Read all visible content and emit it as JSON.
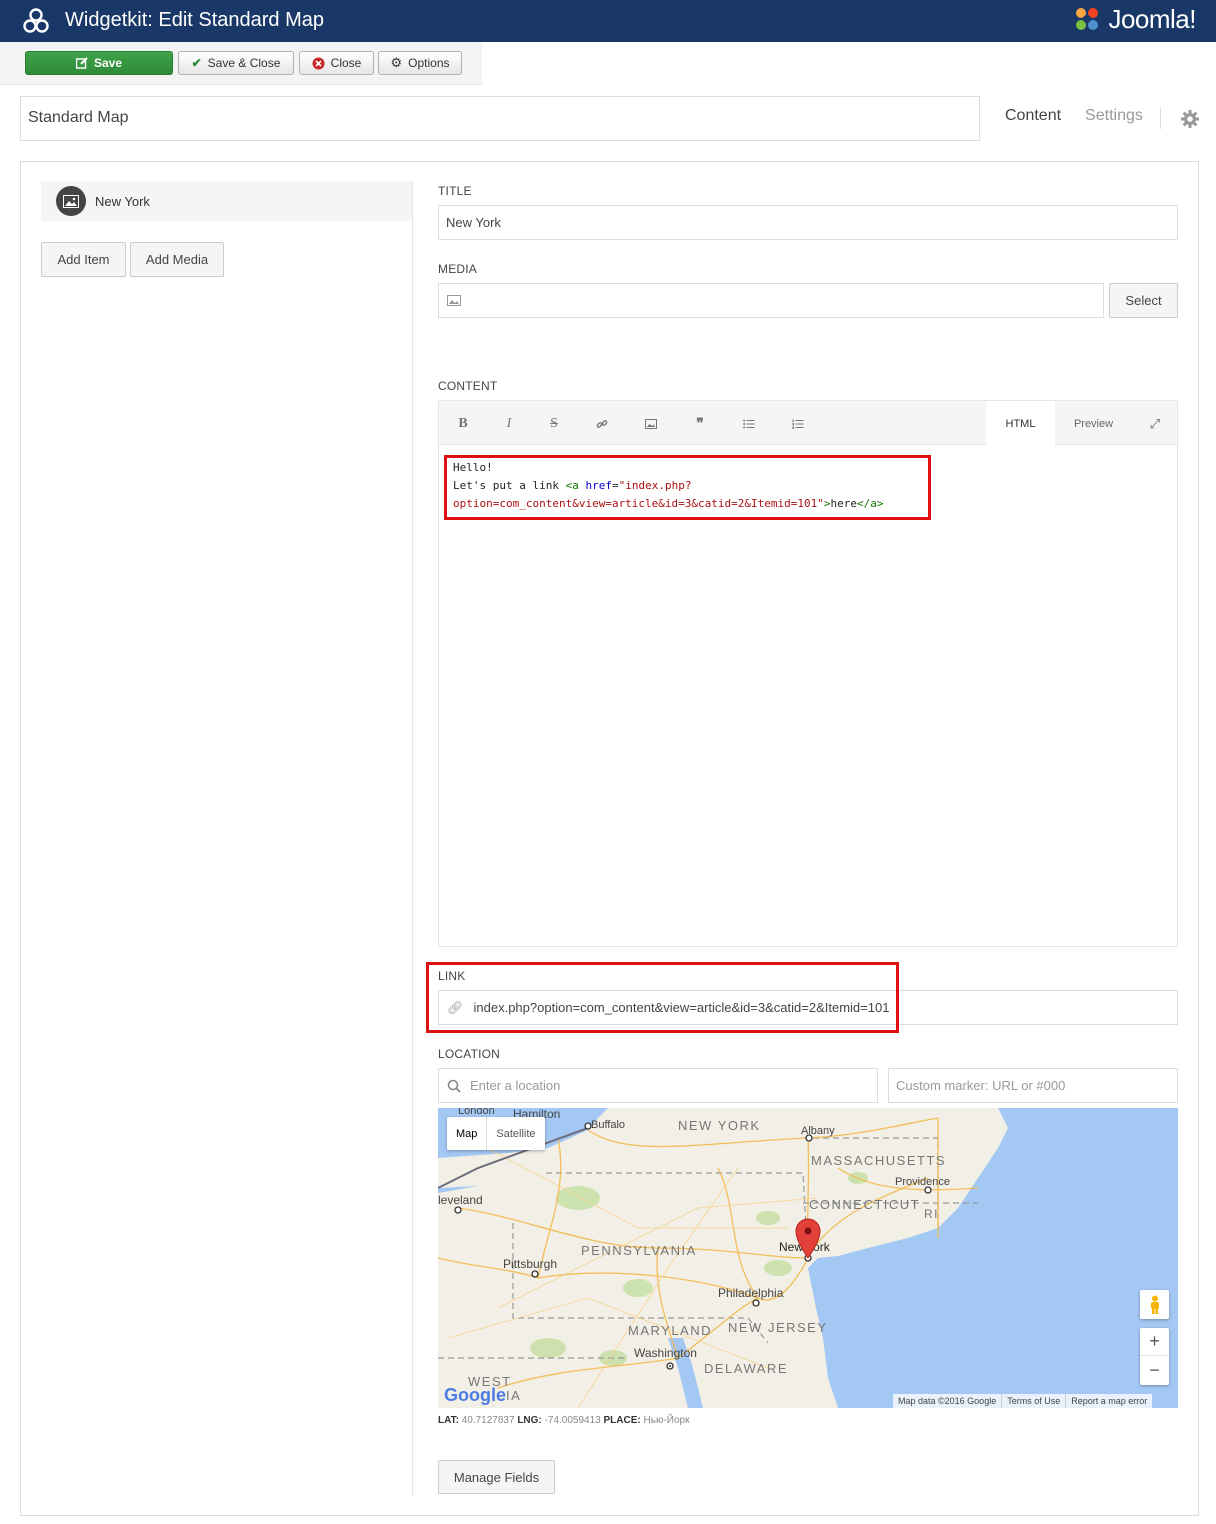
{
  "app": {
    "title": "Widgetkit: Edit Standard Map",
    "brand": "Joomla!",
    "brand_mark": "®"
  },
  "toolbar": {
    "save": "Save",
    "save_close": "Save & Close",
    "close": "Close",
    "options": "Options"
  },
  "widget": {
    "name": "Standard Map"
  },
  "tabs": {
    "content": "Content",
    "settings": "Settings"
  },
  "items": [
    {
      "label": "New York"
    }
  ],
  "item_actions": {
    "add_item": "Add Item",
    "add_media": "Add Media"
  },
  "fields": {
    "title_label": "TITLE",
    "title_value": "New York",
    "media_label": "MEDIA",
    "media_select": "Select",
    "content_label": "CONTENT",
    "link_label": "LINK",
    "link_value": "index.php?option=com_content&view=article&id=3&catid=2&Itemid=101",
    "location_label": "LOCATION",
    "location_placeholder": "Enter a location",
    "marker_placeholder": "Custom marker: URL or #000"
  },
  "editor": {
    "tab_html": "HTML",
    "tab_preview": "Preview",
    "tools": [
      "bold-icon",
      "italic-icon",
      "strikethrough-icon",
      "link-icon",
      "image-icon",
      "quote-icon",
      "list-ul-icon",
      "list-ol-icon"
    ],
    "line1": "Hello!",
    "line2_text": "Let's put a link ",
    "line2_tag_open": "<a ",
    "line2_attr": "href",
    "line2_eq": "=",
    "line2_str_start": "\"index.php?",
    "line3_str_end": "option=com_content&view=article&id=3&catid=2&Itemid=101\"",
    "line3_close": ">",
    "line3_text": "here",
    "line3_tag_close": "</a>"
  },
  "map": {
    "type_map": "Map",
    "type_satellite": "Satellite",
    "labels": [
      "London",
      "Hamilton",
      "Buffalo",
      "NEW YORK",
      "Albany",
      "MASSACHUSETTS",
      "Providence",
      "leveland",
      "CONNECTICUT",
      "RI",
      "PENNSYLVANIA",
      "New York",
      "Pittsburgh",
      "Philadelphia",
      "MARYLAND",
      "NEW JERSEY",
      "Washington",
      "DELAWARE",
      "WEST",
      "IA"
    ],
    "zoom_in": "+",
    "zoom_out": "−",
    "attribution": [
      "Map data ©2016 Google",
      "Terms of Use",
      "Report a map error"
    ],
    "google": "Google",
    "colors": {
      "land": "#f2efe6",
      "water": "#a4c8f4",
      "road": "#f4b84a",
      "park": "#c8e0a8",
      "pin": "#e3403a"
    }
  },
  "coords": {
    "lat_label": "LAT:",
    "lat": "40.7127837",
    "lng_label": "LNG:",
    "lng": "-74.0059413",
    "place_label": "PLACE:",
    "place": "Нью-Йорк"
  },
  "manage_fields": "Manage Fields"
}
